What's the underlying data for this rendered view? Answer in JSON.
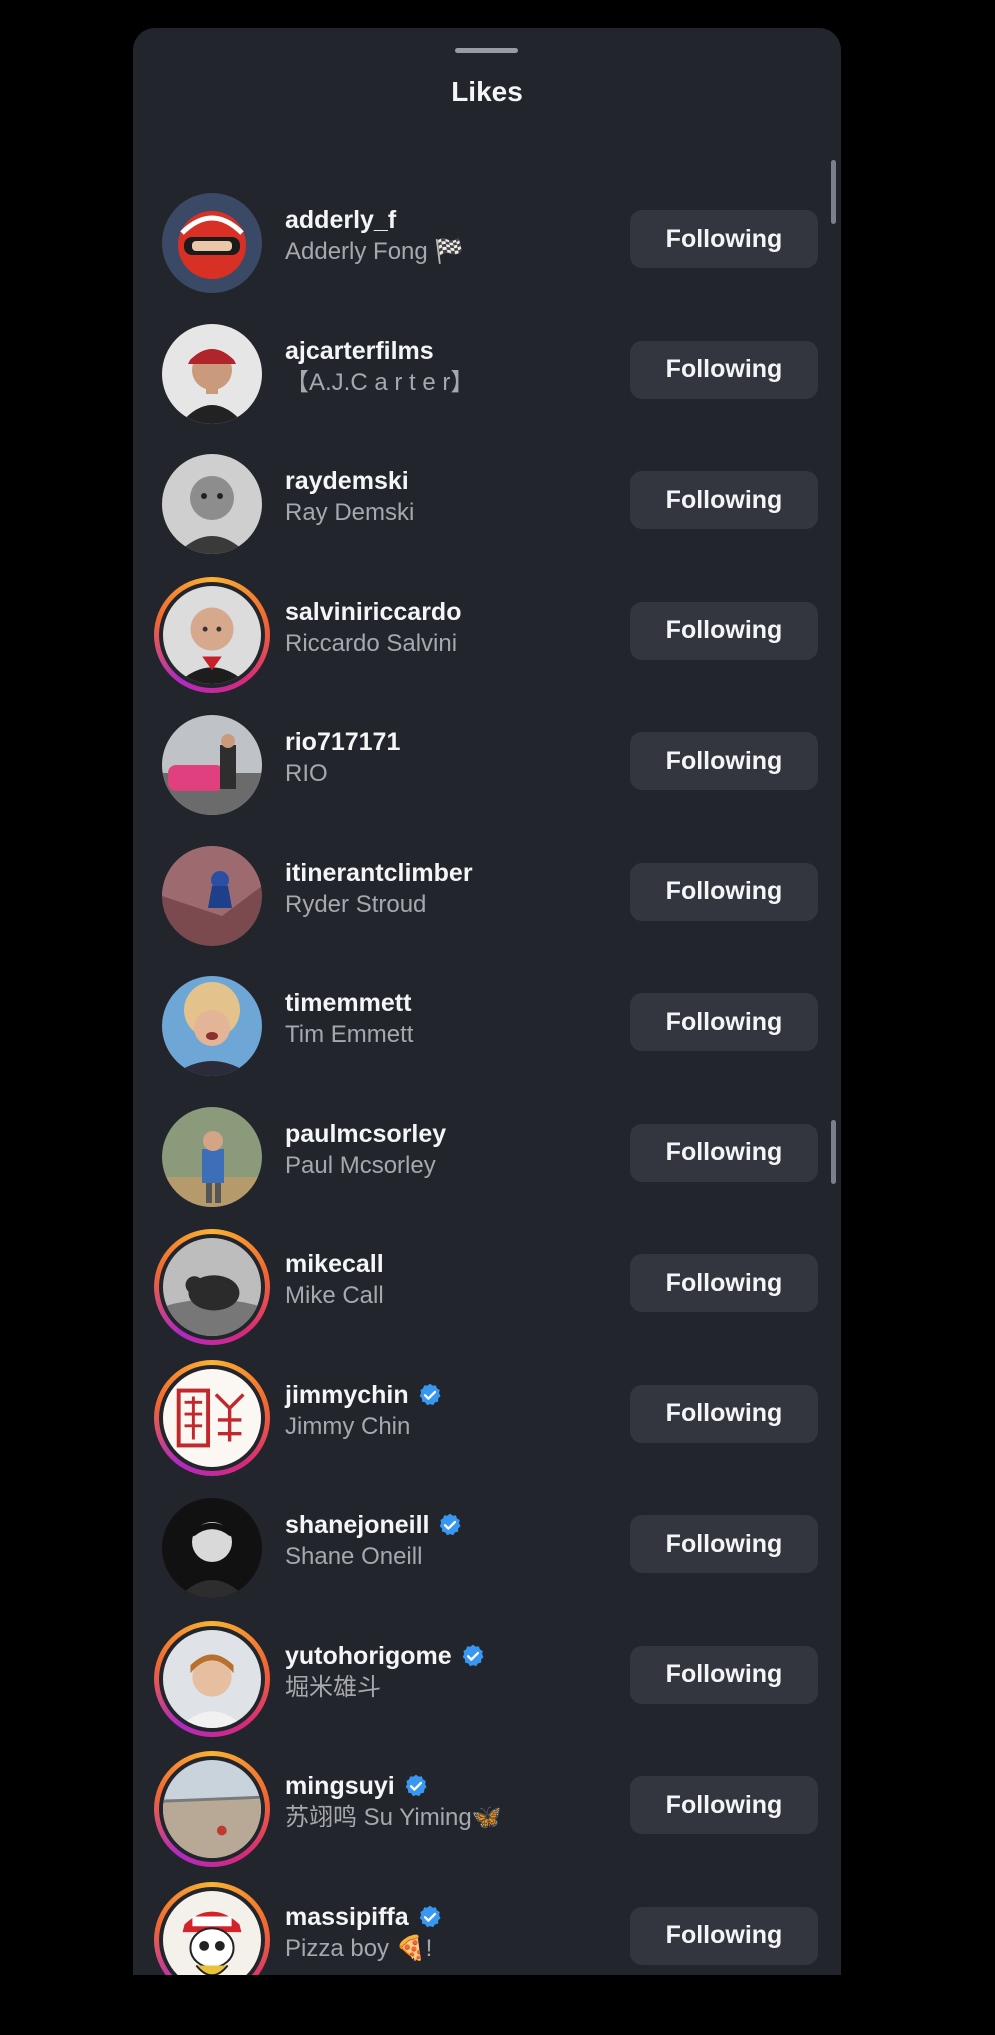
{
  "sheet": {
    "title": "Likes"
  },
  "button_label": "Following",
  "users": [
    {
      "username": "adderly_f",
      "name": "Adderly Fong 🏁",
      "verified": false,
      "story_ring": false,
      "avatar": "racing-helmet-avatar"
    },
    {
      "username": "ajcarterfilms",
      "name": "【A.J.C a r t e r】",
      "verified": false,
      "story_ring": false,
      "avatar": "man-red-cap-avatar"
    },
    {
      "username": "raydemski",
      "name": "Ray Demski",
      "verified": false,
      "story_ring": false,
      "avatar": "bw-portrait-avatar"
    },
    {
      "username": "salviniriccardo",
      "name": "Riccardo Salvini",
      "verified": false,
      "story_ring": true,
      "avatar": "bald-man-avatar"
    },
    {
      "username": "rio717171",
      "name": "RIO",
      "verified": false,
      "story_ring": false,
      "avatar": "pink-car-avatar"
    },
    {
      "username": "itinerantclimber",
      "name": "Ryder Stroud",
      "verified": false,
      "story_ring": false,
      "avatar": "climber-rock-avatar"
    },
    {
      "username": "timemmett",
      "name": "Tim Emmett",
      "verified": false,
      "story_ring": false,
      "avatar": "curly-hair-avatar"
    },
    {
      "username": "paulmcsorley",
      "name": "Paul Mcsorley",
      "verified": false,
      "story_ring": false,
      "avatar": "outdoor-man-avatar"
    },
    {
      "username": "mikecall",
      "name": "Mike Call",
      "verified": false,
      "story_ring": true,
      "avatar": "bw-animal-avatar"
    },
    {
      "username": "jimmychin",
      "name": "Jimmy Chin",
      "verified": true,
      "story_ring": true,
      "avatar": "red-seal-avatar"
    },
    {
      "username": "shanejoneill",
      "name": "Shane Oneill",
      "verified": true,
      "story_ring": false,
      "avatar": "bw-man-avatar"
    },
    {
      "username": "yutohorigome",
      "name": "堀米雄斗",
      "verified": true,
      "story_ring": true,
      "avatar": "young-man-avatar"
    },
    {
      "username": "mingsuyi",
      "name": "苏翊鸣 Su Yiming🦋",
      "verified": true,
      "story_ring": true,
      "avatar": "snow-field-avatar"
    },
    {
      "username": "massipiffa",
      "name": "Pizza boy 🍕!",
      "verified": true,
      "story_ring": true,
      "avatar": "skull-cap-avatar"
    }
  ],
  "colors": {
    "sheet_bg": "#23252c",
    "button_bg": "#33363e",
    "verified_blue": "#3897f0"
  }
}
